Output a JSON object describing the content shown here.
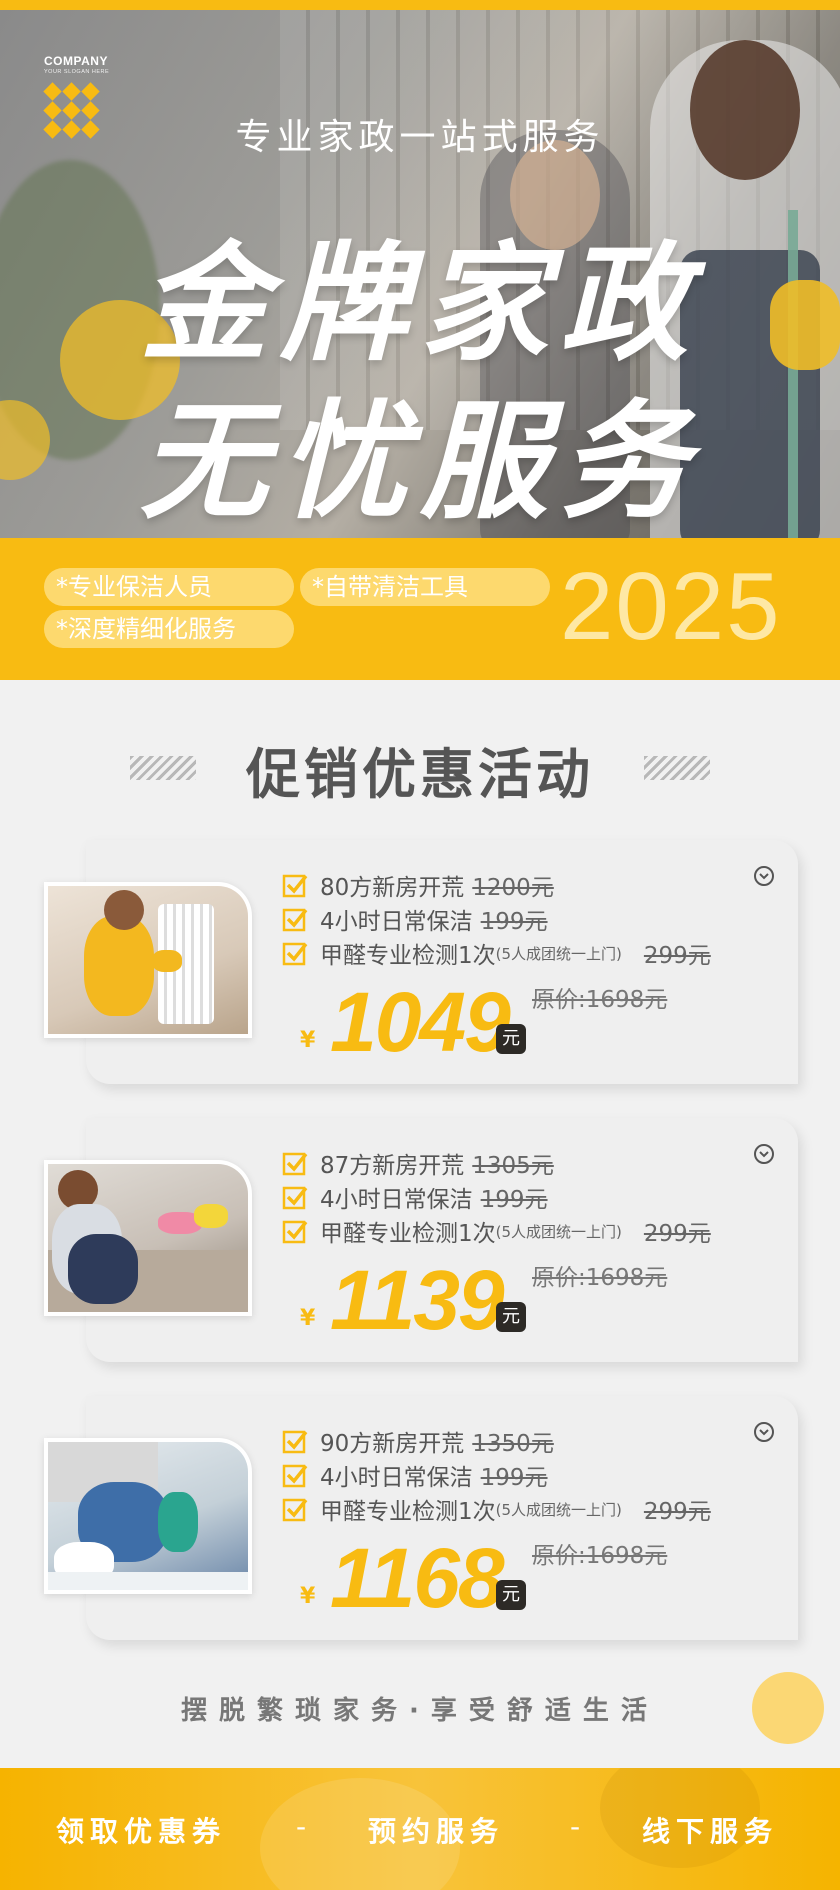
{
  "brand": {
    "company": "COMPANY",
    "slogan": "YOUR SLOGAN HERE"
  },
  "hero": {
    "subtitle": "专业家政一站式服务",
    "title_line1": "金牌家政",
    "title_line2": "无忧服务"
  },
  "features": [
    "*专业保洁人员",
    "*自带清洁工具",
    "*深度精细化服务"
  ],
  "year": "2025",
  "promo_title": "促销优惠活动",
  "packages": [
    {
      "items": [
        {
          "label": "80方新房开荒",
          "price": "1200元"
        },
        {
          "label": "4小时日常保洁",
          "price": "199元"
        },
        {
          "label": "甲醛专业检测1次",
          "note": "(5人成团统一上门)",
          "price": "299元"
        }
      ],
      "currency": "¥",
      "price": "1049",
      "unit": "元",
      "original": "原价:1698元"
    },
    {
      "items": [
        {
          "label": "87方新房开荒",
          "price": "1305元"
        },
        {
          "label": "4小时日常保洁",
          "price": "199元"
        },
        {
          "label": "甲醛专业检测1次",
          "note": "(5人成团统一上门)",
          "price": "299元"
        }
      ],
      "currency": "¥",
      "price": "1139",
      "unit": "元",
      "original": "原价:1698元"
    },
    {
      "items": [
        {
          "label": "90方新房开荒",
          "price": "1350元"
        },
        {
          "label": "4小时日常保洁",
          "price": "199元"
        },
        {
          "label": "甲醛专业检测1次",
          "note": "(5人成团统一上门)",
          "price": "299元"
        }
      ],
      "currency": "¥",
      "price": "1168",
      "unit": "元",
      "original": "原价:1698元"
    }
  ],
  "footer_slogan": "摆脱繁琐家务·享受舒适生活",
  "actions": [
    "领取优惠券",
    "预约服务",
    "线下服务"
  ],
  "action_separator": "-",
  "colors": {
    "accent": "#f8bb12",
    "text": "#555555",
    "background": "#f1f1f1"
  }
}
